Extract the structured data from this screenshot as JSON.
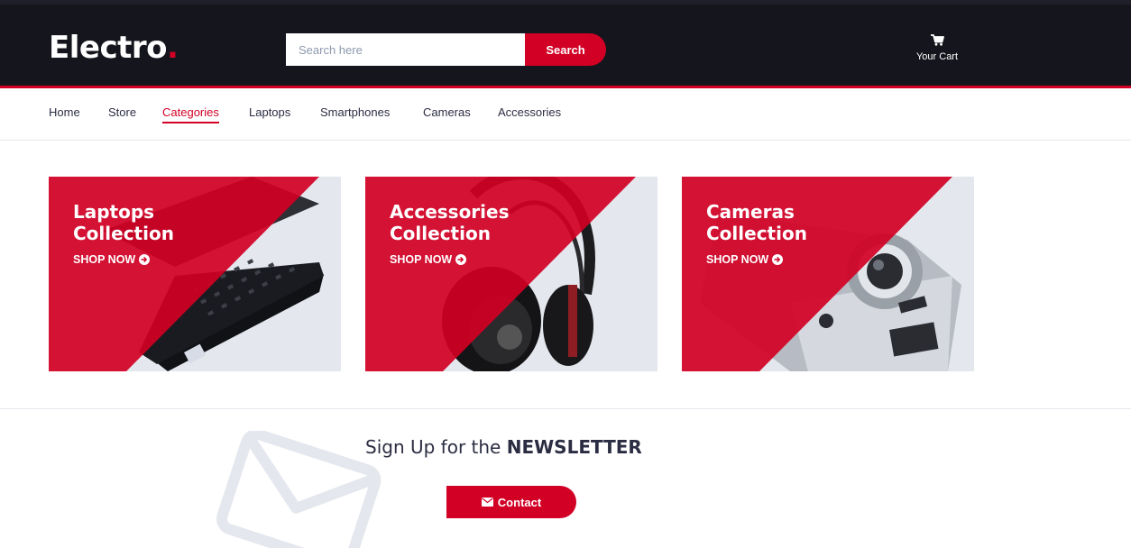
{
  "header": {
    "logo_text": "Electro",
    "logo_dot": ".",
    "search": {
      "placeholder": "Search here",
      "value": ""
    },
    "search_button_label": "Search",
    "cart_label": "Your Cart",
    "cart_icon": "shopping-cart-icon"
  },
  "nav": {
    "items": [
      {
        "label": "Home",
        "active": false
      },
      {
        "label": "Store",
        "active": false
      },
      {
        "label": "Categories",
        "active": true
      },
      {
        "label": "Laptops",
        "active": false
      },
      {
        "label": "Smartphones",
        "active": false
      },
      {
        "label": "Cameras",
        "active": false
      },
      {
        "label": "Accessories",
        "active": false
      }
    ]
  },
  "collections": [
    {
      "line1": "Laptops",
      "line2": "Collection",
      "cta": "SHOP NOW",
      "image": "laptop"
    },
    {
      "line1": "Accessories",
      "line2": "Collection",
      "cta": "SHOP NOW",
      "image": "headphones"
    },
    {
      "line1": "Cameras",
      "line2": "Collection",
      "cta": "SHOP NOW",
      "image": "camera"
    }
  ],
  "newsletter": {
    "title_prefix": "Sign Up for the",
    "title_bold": "NEWSLETTER",
    "contact_label": "Contact",
    "contact_icon": "envelope-icon",
    "background_icon": "envelope-outline-icon"
  },
  "colors": {
    "primary": "#d10024",
    "header_bg": "#15161d",
    "card_bg": "#e4e7ed",
    "text_dark": "#2b2d42"
  }
}
